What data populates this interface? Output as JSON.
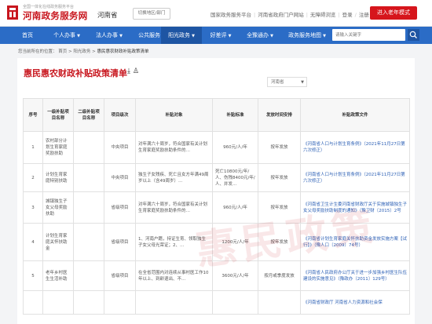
{
  "header": {
    "logo_subtitle": "全国一体化在线政务服务平台",
    "site_title": "河南政务服务网",
    "province": "河南省",
    "city_switch": "切换地区/部门",
    "top_links": [
      "国家政务服务平台",
      "河南省政府门户网站",
      "无障碍浏览",
      "登录",
      "注册"
    ],
    "elder_mode": "进入老年模式"
  },
  "nav": {
    "items": [
      {
        "label": "首页",
        "dropdown": false
      },
      {
        "label": "个人办事",
        "dropdown": true
      },
      {
        "label": "法人办事",
        "dropdown": true
      },
      {
        "label": "公共服务",
        "dropdown": false
      },
      {
        "label": "阳光政务",
        "dropdown": true
      },
      {
        "label": "好差评",
        "dropdown": true
      },
      {
        "label": "全豫通办",
        "dropdown": true
      },
      {
        "label": "政务服务地图",
        "dropdown": true
      }
    ],
    "search_placeholder": "请输入关键字"
  },
  "breadcrumb": {
    "prefix": "您当前所在的位置：",
    "items": [
      "首页",
      "阳光政务",
      "惠民惠农财政补贴政策清单"
    ]
  },
  "main": {
    "title": "惠民惠农财政补贴政策清单",
    "region_select": "河南省",
    "columns": [
      "序号",
      "一级补贴项目名称",
      "二级补贴项目名称",
      "项目级次",
      "补贴对象",
      "补贴标准",
      "发放时间安排",
      "补贴政策文件"
    ],
    "rows": [
      {
        "no": "1",
        "level1": "农村部分计划生育家庭奖励扶助",
        "level2": "",
        "tier": "中央项目",
        "target": "对年满六十周岁，符合国家有关计划生育家庭奖励扶助条件的…",
        "standard": "960元/人/年",
        "schedule": "按年发放",
        "doc": "《河南省人口与计划生育条例》（2021年11月27日第六次修正）"
      },
      {
        "no": "2",
        "level1": "计划生育家庭特别扶助",
        "level2": "",
        "tier": "中央项目",
        "target": "独生子女残疾、死亡且女方年满49周岁以上（含49周岁）…",
        "standard": "死亡10800元/年/人、伤残8400元/年/人、并发…",
        "schedule": "按年发放",
        "doc": "《河南省人口与计划生育条例》（2021年11月27日第六次修正）"
      },
      {
        "no": "3",
        "level1": "城镇独生子女父母奖励扶助",
        "level2": "",
        "tier": "省级项目",
        "target": "对年满六十周岁，符合国家有关计划生育家庭奖励扶助条件的…",
        "standard": "960元/人/年",
        "schedule": "按年发放",
        "doc": "《河南省卫生计生委河南省财政厅关于实施城镇独生子女父母奖励扶助制度的通知》（豫卫财〔2015〕2号"
      },
      {
        "no": "4",
        "level1": "计划生育家庭关怀扶助金",
        "level2": "",
        "tier": "省级项目",
        "target": "1、河南户籍，持证生育、领取独生子女父母光荣证；2、…",
        "standard": "1200元/人/年",
        "schedule": "按年发放",
        "doc": "《河南省计划生育家庭关怀扶助资金发放实施方案【试行】》（豫人口〔2009〕74号）"
      },
      {
        "no": "5",
        "level1": "老年乡村医生生活补助",
        "level2": "",
        "tier": "省级项目",
        "target": "在全省范围内对连续从事村医工作10年以上、到龄退出、不…",
        "standard": "3600元/人/年",
        "schedule": "按月或季度发放",
        "doc": "《河南省人民政府办公厅关于进一步加强乡村医生队伍建设的实施意见》（豫政办〔2011〕129号）"
      },
      {
        "no": "",
        "level1": "",
        "level2": "",
        "tier": "",
        "target": "",
        "standard": "",
        "schedule": "",
        "doc": "《河南省财政厅 河南省人力资源和社会保"
      }
    ]
  },
  "watermark": "惠民政策",
  "colors": {
    "brand_red": "#c8161e",
    "nav_blue": "#2b6cc6",
    "link_blue": "#2b5fb5"
  }
}
